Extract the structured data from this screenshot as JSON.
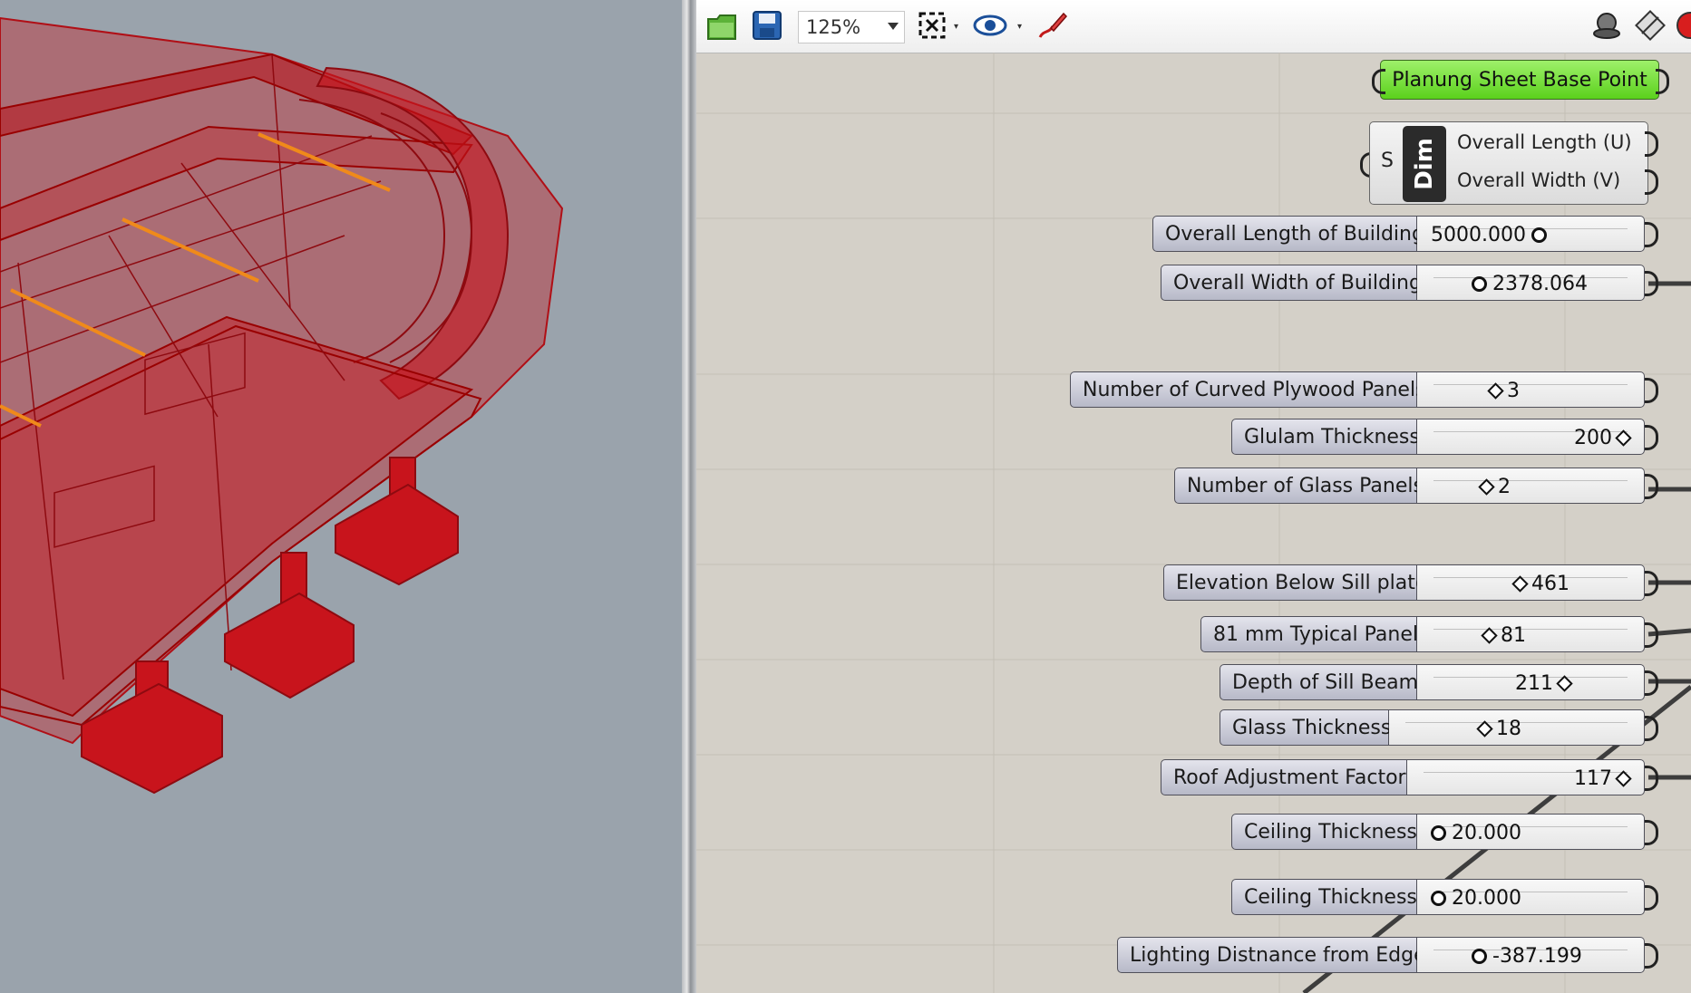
{
  "toolbar": {
    "zoom_value": "125%",
    "icons": [
      "open-file-icon",
      "save-icon",
      "zoom-extents-icon",
      "preview-eye-icon",
      "sketch-pen-icon",
      "shaded-preview-icon",
      "wireframe-icon",
      "record-icon"
    ]
  },
  "canvas": {
    "base_point_label": "Planung Sheet Base Point",
    "dim_component": {
      "input_label": "S",
      "tag": "Dim",
      "outputs": [
        "Overall Length (U)",
        "Overall Width (V)"
      ]
    },
    "sliders": [
      {
        "label": "Overall Length of Building",
        "value": "5000.000"
      },
      {
        "label": "Overall Width of Building",
        "value": "2378.064"
      },
      {
        "label": "Number of Curved Plywood Panels",
        "value": "3"
      },
      {
        "label": "Glulam Thickness",
        "value": "200"
      },
      {
        "label": "Number of Glass Panels",
        "value": "2"
      },
      {
        "label": "Elevation Below Sill plate",
        "value": "461"
      },
      {
        "label": "81 mm Typical Panel",
        "value": "81"
      },
      {
        "label": "Depth of Sill Beam",
        "value": "211"
      },
      {
        "label": "Glass Thickness",
        "value": "18"
      },
      {
        "label": "Roof Adjustment Factor",
        "value": "117"
      },
      {
        "label": "Ceiling Thickness",
        "value": "20.000"
      },
      {
        "label": "Ceiling Thickness",
        "value": "20.000"
      },
      {
        "label": "Lighting Distnance from Edge",
        "value": "-387.199"
      }
    ]
  },
  "colors": {
    "model_red": "#c8141c",
    "viewport_bg": "#9aa3ac",
    "canvas_bg": "#d4d0c8",
    "base_point_green": "#6bd82a"
  }
}
